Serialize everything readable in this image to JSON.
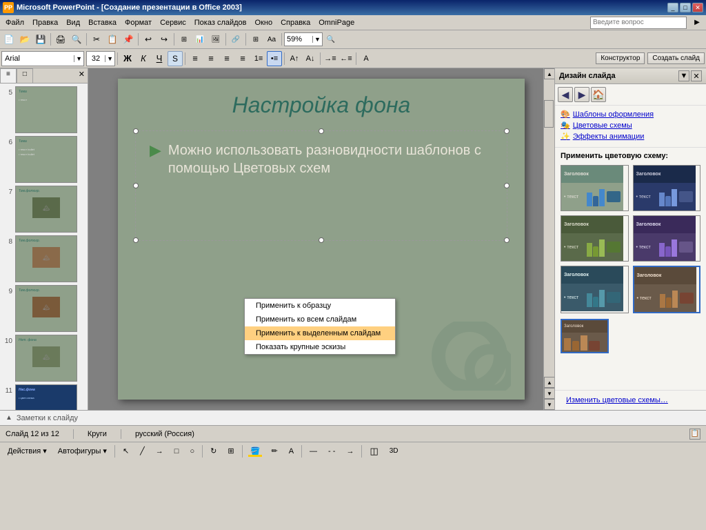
{
  "window": {
    "title": "Microsoft PowerPoint - [Создание презентации в Office 2003]",
    "icon": "PP"
  },
  "titleControls": [
    "_",
    "□",
    "✕"
  ],
  "menuBar": {
    "items": [
      "Файл",
      "Правка",
      "Вид",
      "Вставка",
      "Формат",
      "Сервис",
      "Показ слайдов",
      "Окно",
      "Справка",
      "OmniPage"
    ]
  },
  "searchBox": {
    "placeholder": "Введите вопрос"
  },
  "toolbar": {
    "zoomValue": "59%"
  },
  "formatBar": {
    "font": "Arial",
    "size": "32",
    "buttons": [
      "Ж",
      "К",
      "Ч",
      "S"
    ],
    "rightButtons": [
      "Конструктор",
      "Создать слайд"
    ]
  },
  "panelTabs": {
    "tab1": "≡",
    "tab2": "□"
  },
  "slides": [
    {
      "num": "5",
      "selected": false
    },
    {
      "num": "6",
      "selected": false
    },
    {
      "num": "7",
      "selected": false
    },
    {
      "num": "8",
      "selected": false
    },
    {
      "num": "9",
      "selected": false
    },
    {
      "num": "10",
      "selected": false
    },
    {
      "num": "11",
      "selected": false
    },
    {
      "num": "12",
      "selected": true
    }
  ],
  "slideContent": {
    "title": "Настройка фона",
    "bullet": "Можно использовать разновидности шаблонов с помощью Цветовых схем"
  },
  "rightPanel": {
    "title": "Дизайн слайда",
    "links": [
      "Шаблоны оформления",
      "Цветовые схемы",
      "Эффекты анимации"
    ],
    "sectionTitle": "Применить цветовую схему:",
    "footerLink": "Изменить цветовые схемы…",
    "colorSchemes": [
      {
        "headerBg": "#6a8a7a",
        "headerText": "Заголовок",
        "bodyBg": "#8fa08a",
        "textColor": "#e0ddd5",
        "barColors": [
          "#4488cc",
          "#66aacc",
          "#88cccc"
        ],
        "iconBg": "#336688"
      },
      {
        "headerBg": "#2a3a5a",
        "headerText": "Заголовок",
        "bodyBg": "#3a4a6a",
        "textColor": "#ccccdd",
        "barColors": [
          "#6688cc",
          "#8899dd",
          "#99aaee"
        ],
        "iconBg": "#445588"
      },
      {
        "headerBg": "#5a6a4a",
        "headerText": "Заголовок",
        "bodyBg": "#6a7a5a",
        "textColor": "#ddddcc",
        "barColors": [
          "#88aa44",
          "#aabb55",
          "#cccc66"
        ],
        "iconBg": "#557733"
      },
      {
        "headerBg": "#4a3a6a",
        "headerText": "Заголовок",
        "bodyBg": "#5a4a7a",
        "textColor": "#ddd8ee",
        "barColors": [
          "#8866cc",
          "#aa88dd",
          "#cc99ee"
        ],
        "iconBg": "#665588"
      },
      {
        "headerBg": "#3a5a6a",
        "headerText": "Заголовок",
        "bodyBg": "#4a6a7a",
        "textColor": "#ddeeee",
        "barColors": [
          "#448899",
          "#5599aa",
          "#66aaaa"
        ],
        "iconBg": "#336677"
      },
      {
        "headerBg": "#5a4a3a",
        "headerText": "Заголовок",
        "bodyBg": "#6a5a4a",
        "textColor": "#eeddcc",
        "barColors": [
          "#aa7744",
          "#bb8855",
          "#cc9966"
        ],
        "iconBg": "#774433",
        "selected": true
      }
    ]
  },
  "contextMenu": {
    "items": [
      "Применить к образцу",
      "Применить ко всем слайдам",
      "Применить к выделенным слайдам",
      "Показать крупные эскизы"
    ],
    "highlightedIndex": 2
  },
  "statusBar": {
    "slide": "Слайд 12 из 12",
    "shape": "Круги",
    "language": "русский (Россия)"
  },
  "notesBar": {
    "label": "Заметки к слайду"
  },
  "drawingBar": {
    "actions": "Действия ▾",
    "autoshapes": "Автофигуры ▾"
  }
}
